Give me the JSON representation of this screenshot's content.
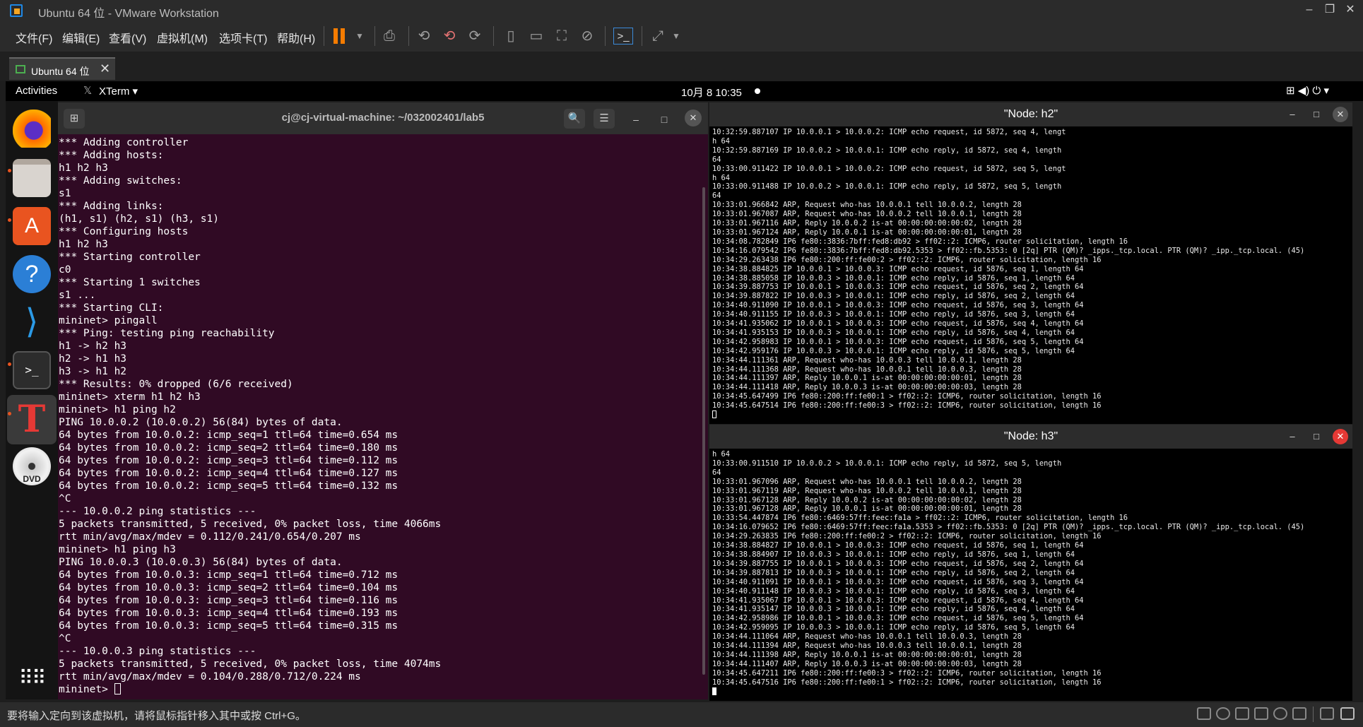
{
  "window": {
    "title": "Ubuntu 64 位 - VMware Workstation",
    "minimize": "–",
    "restore": "❐",
    "close": "✕"
  },
  "menu": [
    "文件(F)",
    "编辑(E)",
    "查看(V)",
    "虚拟机(M)",
    "选项卡(T)",
    "帮助(H)"
  ],
  "tab": {
    "label": "Ubuntu 64 位",
    "close": "✕"
  },
  "panel": {
    "activities": "Activities",
    "app": "XTerm ▾",
    "clock": "10月 8  10:35",
    "indicators": "⊞  ◀)  ⏻ ▾"
  },
  "dock": [
    "firefox-icon",
    "files-icon",
    "software-icon",
    "help-icon",
    "vscode-icon",
    "terminal-icon",
    "xterm-icon",
    "dvd-icon",
    "apps-grid-icon"
  ],
  "terminal": {
    "title": "cj@cj-virtual-machine: ~/032002401/lab5",
    "new_tab": "⊞",
    "search": "🔍",
    "menu": "☰",
    "minimize": "–",
    "maximize": "□",
    "close": "✕",
    "lines": [
      "*** Adding controller",
      "*** Adding hosts:",
      "h1 h2 h3",
      "*** Adding switches:",
      "s1",
      "*** Adding links:",
      "(h1, s1) (h2, s1) (h3, s1)",
      "*** Configuring hosts",
      "h1 h2 h3",
      "*** Starting controller",
      "c0",
      "*** Starting 1 switches",
      "s1 ...",
      "*** Starting CLI:",
      "mininet> pingall",
      "*** Ping: testing ping reachability",
      "h1 -> h2 h3",
      "h2 -> h1 h3",
      "h3 -> h1 h2",
      "*** Results: 0% dropped (6/6 received)",
      "mininet> xterm h1 h2 h3",
      "mininet> h1 ping h2",
      "PING 10.0.0.2 (10.0.0.2) 56(84) bytes of data.",
      "64 bytes from 10.0.0.2: icmp_seq=1 ttl=64 time=0.654 ms",
      "64 bytes from 10.0.0.2: icmp_seq=2 ttl=64 time=0.180 ms",
      "64 bytes from 10.0.0.2: icmp_seq=3 ttl=64 time=0.112 ms",
      "64 bytes from 10.0.0.2: icmp_seq=4 ttl=64 time=0.127 ms",
      "64 bytes from 10.0.0.2: icmp_seq=5 ttl=64 time=0.132 ms",
      "^C",
      "--- 10.0.0.2 ping statistics ---",
      "5 packets transmitted, 5 received, 0% packet loss, time 4066ms",
      "rtt min/avg/max/mdev = 0.112/0.241/0.654/0.207 ms",
      "mininet> h1 ping h3",
      "PING 10.0.0.3 (10.0.0.3) 56(84) bytes of data.",
      "64 bytes from 10.0.0.3: icmp_seq=1 ttl=64 time=0.712 ms",
      "64 bytes from 10.0.0.3: icmp_seq=2 ttl=64 time=0.104 ms",
      "64 bytes from 10.0.0.3: icmp_seq=3 ttl=64 time=0.116 ms",
      "64 bytes from 10.0.0.3: icmp_seq=4 ttl=64 time=0.193 ms",
      "64 bytes from 10.0.0.3: icmp_seq=5 ttl=64 time=0.315 ms",
      "^C",
      "--- 10.0.0.3 ping statistics ---",
      "5 packets transmitted, 5 received, 0% packet loss, time 4074ms",
      "rtt min/avg/max/mdev = 0.104/0.288/0.712/0.224 ms"
    ],
    "prompt": "mininet> "
  },
  "xterm_h2": {
    "title": "\"Node: h2\"",
    "lines": [
      "10:32:59.887107 IP 10.0.0.1 > 10.0.0.2: ICMP echo request, id 5872, seq 4, lengt",
      "h 64",
      "10:32:59.887169 IP 10.0.0.2 > 10.0.0.1: ICMP echo reply, id 5872, seq 4, length",
      "64",
      "10:33:00.911422 IP 10.0.0.1 > 10.0.0.2: ICMP echo request, id 5872, seq 5, lengt",
      "h 64",
      "10:33:00.911488 IP 10.0.0.2 > 10.0.0.1: ICMP echo reply, id 5872, seq 5, length",
      "64",
      "10:33:01.966842 ARP, Request who-has 10.0.0.1 tell 10.0.0.2, length 28",
      "10:33:01.967087 ARP, Request who-has 10.0.0.2 tell 10.0.0.1, length 28",
      "10:33:01.967116 ARP, Reply 10.0.0.2 is-at 00:00:00:00:00:02, length 28",
      "10:33:01.967124 ARP, Reply 10.0.0.1 is-at 00:00:00:00:00:01, length 28",
      "10:34:08.782849 IP6 fe80::3836:7bff:fed8:db92 > ff02::2: ICMP6, router solicitation, length 16",
      "10:34:16.079542 IP6 fe80::3836:7bff:fed8:db92.5353 > ff02::fb.5353: 0 [2q] PTR (QM)? _ipps._tcp.local. PTR (QM)? _ipp._tcp.local. (45)",
      "10:34:29.263438 IP6 fe80::200:ff:fe00:2 > ff02::2: ICMP6, router solicitation, length 16",
      "10:34:38.884825 IP 10.0.0.1 > 10.0.0.3: ICMP echo request, id 5876, seq 1, length 64",
      "10:34:38.885058 IP 10.0.0.3 > 10.0.0.1: ICMP echo reply, id 5876, seq 1, length 64",
      "10:34:39.887753 IP 10.0.0.1 > 10.0.0.3: ICMP echo request, id 5876, seq 2, length 64",
      "10:34:39.887822 IP 10.0.0.3 > 10.0.0.1: ICMP echo reply, id 5876, seq 2, length 64",
      "10:34:40.911090 IP 10.0.0.1 > 10.0.0.3: ICMP echo request, id 5876, seq 3, length 64",
      "10:34:40.911155 IP 10.0.0.3 > 10.0.0.1: ICMP echo reply, id 5876, seq 3, length 64",
      "10:34:41.935062 IP 10.0.0.1 > 10.0.0.3: ICMP echo request, id 5876, seq 4, length 64",
      "10:34:41.935153 IP 10.0.0.3 > 10.0.0.1: ICMP echo reply, id 5876, seq 4, length 64",
      "10:34:42.958983 IP 10.0.0.1 > 10.0.0.3: ICMP echo request, id 5876, seq 5, length 64",
      "10:34:42.959176 IP 10.0.0.3 > 10.0.0.1: ICMP echo reply, id 5876, seq 5, length 64",
      "10:34:44.111361 ARP, Request who-has 10.0.0.3 tell 10.0.0.1, length 28",
      "10:34:44.111368 ARP, Request who-has 10.0.0.1 tell 10.0.0.3, length 28",
      "10:34:44.111397 ARP, Reply 10.0.0.1 is-at 00:00:00:00:00:01, length 28",
      "10:34:44.111418 ARP, Reply 10.0.0.3 is-at 00:00:00:00:00:03, length 28",
      "10:34:45.647499 IP6 fe80::200:ff:fe00:1 > ff02::2: ICMP6, router solicitation, length 16",
      "10:34:45.647514 IP6 fe80::200:ff:fe00:3 > ff02::2: ICMP6, router solicitation, length 16"
    ]
  },
  "xterm_h3": {
    "title": "\"Node: h3\"",
    "lines": [
      "h 64",
      "10:33:00.911510 IP 10.0.0.2 > 10.0.0.1: ICMP echo reply, id 5872, seq 5, length",
      "64",
      "10:33:01.967096 ARP, Request who-has 10.0.0.1 tell 10.0.0.2, length 28",
      "10:33:01.967119 ARP, Request who-has 10.0.0.2 tell 10.0.0.1, length 28",
      "10:33:01.967128 ARP, Reply 10.0.0.2 is-at 00:00:00:00:00:02, length 28",
      "10:33:01.967128 ARP, Reply 10.0.0.1 is-at 00:00:00:00:00:01, length 28",
      "10:33:54.447874 IP6 fe80::6469:57ff:feec:fa1a > ff02::2: ICMP6, router solicitation, length 16",
      "10:34:16.079652 IP6 fe80::6469:57ff:feec:fa1a.5353 > ff02::fb.5353: 0 [2q] PTR (QM)? _ipps._tcp.local. PTR (QM)? _ipp._tcp.local. (45)",
      "10:34:29.263835 IP6 fe80::200:ff:fe00:2 > ff02::2: ICMP6, router solicitation, length 16",
      "10:34:38.884827 IP 10.0.0.1 > 10.0.0.3: ICMP echo request, id 5876, seq 1, length 64",
      "10:34:38.884907 IP 10.0.0.3 > 10.0.0.1: ICMP echo reply, id 5876, seq 1, length 64",
      "10:34:39.887755 IP 10.0.0.1 > 10.0.0.3: ICMP echo request, id 5876, seq 2, length 64",
      "10:34:39.887813 IP 10.0.0.3 > 10.0.0.1: ICMP echo reply, id 5876, seq 2, length 64",
      "10:34:40.911091 IP 10.0.0.1 > 10.0.0.3: ICMP echo request, id 5876, seq 3, length 64",
      "10:34:40.911148 IP 10.0.0.3 > 10.0.0.1: ICMP echo reply, id 5876, seq 3, length 64",
      "10:34:41.935067 IP 10.0.0.1 > 10.0.0.3: ICMP echo request, id 5876, seq 4, length 64",
      "10:34:41.935147 IP 10.0.0.3 > 10.0.0.1: ICMP echo reply, id 5876, seq 4, length 64",
      "10:34:42.958986 IP 10.0.0.1 > 10.0.0.3: ICMP echo request, id 5876, seq 5, length 64",
      "10:34:42.959095 IP 10.0.0.3 > 10.0.0.1: ICMP echo reply, id 5876, seq 5, length 64",
      "10:34:44.111064 ARP, Request who-has 10.0.0.1 tell 10.0.0.3, length 28",
      "10:34:44.111394 ARP, Request who-has 10.0.0.3 tell 10.0.0.1, length 28",
      "10:34:44.111398 ARP, Reply 10.0.0.1 is-at 00:00:00:00:00:01, length 28",
      "10:34:44.111407 ARP, Reply 10.0.0.3 is-at 00:00:00:00:00:03, length 28",
      "10:34:45.647211 IP6 fe80::200:ff:fe00:3 > ff02::2: ICMP6, router solicitation, length 16",
      "10:34:45.647516 IP6 fe80::200:ff:fe00:1 > ff02::2: ICMP6, router solicitation, length 16"
    ]
  },
  "status": {
    "message": "要将输入定向到该虚拟机，请将鼠标指针移入其中或按 Ctrl+G。"
  },
  "colors": {
    "terminal_bg": "#300a24",
    "ubuntu_orange": "#e95420",
    "vmware_orange": "#f57c00",
    "xterm_close_active": "#e53935"
  }
}
